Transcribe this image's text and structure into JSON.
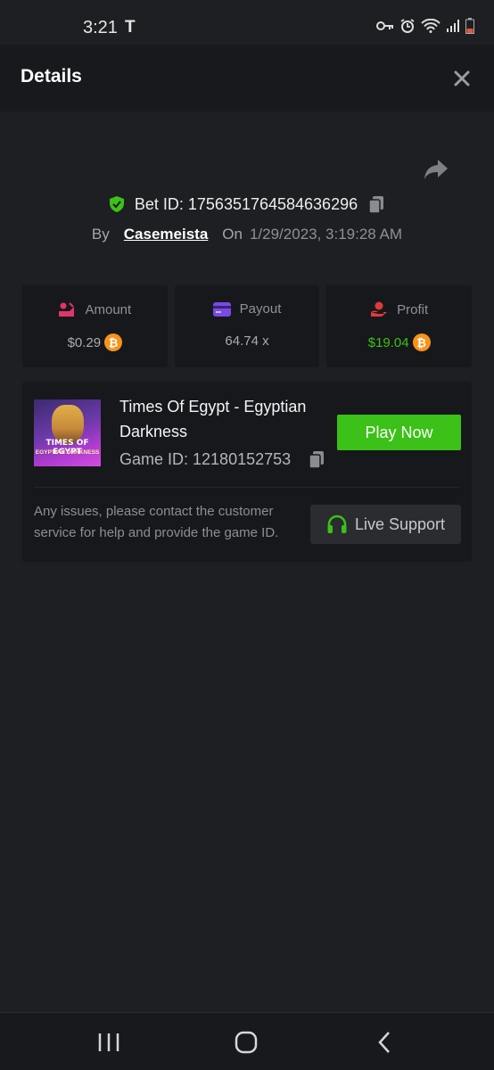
{
  "status_bar": {
    "time": "3:21",
    "carrier_icon": "T",
    "icons": [
      "vpn-key-icon",
      "alarm-icon",
      "wifi-icon",
      "signal-icon",
      "battery-icon"
    ]
  },
  "header": {
    "title": "Details",
    "close_icon": "close-icon"
  },
  "bet": {
    "bet_id_label": "Bet ID: 1756351764584636296",
    "by_label": "By",
    "username": "Casemeista",
    "on_label": "On",
    "date": "1/29/2023, 3:19:28 AM"
  },
  "stats": {
    "amount": {
      "label": "Amount",
      "value": "$0.29",
      "currency_icon": "bitcoin-icon"
    },
    "payout": {
      "label": "Payout",
      "value": "64.74 x"
    },
    "profit": {
      "label": "Profit",
      "value": "$19.04",
      "currency_icon": "bitcoin-icon"
    }
  },
  "game": {
    "title": "Times Of Egypt - Egyptian Darkness",
    "game_id": "Game ID: 12180152753",
    "thumb_line1": "TIMES OF EGYPT",
    "thumb_line2": "EGYPTIAN DARKNESS",
    "play_label": "Play Now"
  },
  "support": {
    "text": "Any issues, please contact the customer service for help and provide the game ID.",
    "button_label": "Live Support"
  },
  "colors": {
    "accent_green": "#3bc117",
    "bitcoin_orange": "#f7931a",
    "amount_icon": "#e0356a",
    "payout_icon": "#7a4ae8",
    "profit_icon": "#e03b3b"
  }
}
